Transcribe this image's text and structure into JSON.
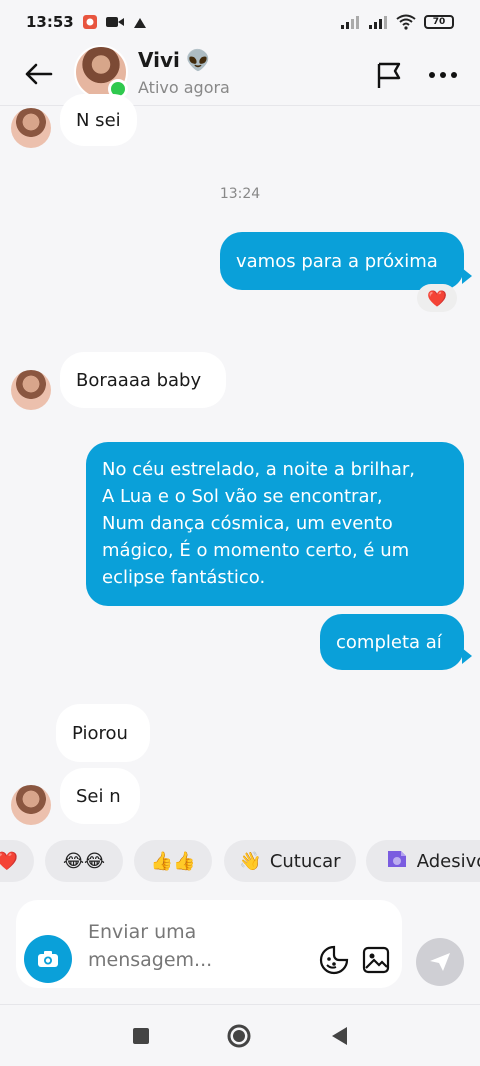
{
  "status_bar": {
    "time": "13:53",
    "battery": "70"
  },
  "header": {
    "name": "Vivi",
    "emoji": "👽",
    "status": "Ativo agora"
  },
  "messages": {
    "m1": "N sei",
    "time": "13:24",
    "m2": "vamos para a próxima",
    "m2_reaction": "❤️",
    "m3": "Boraaaa baby",
    "m4_lines": [
      "No céu estrelado, a noite a brilhar,",
      "A Lua e o Sol vão se encontrar,",
      "Num dança cósmica, um evento",
      "mágico, É o momento certo, é um",
      "eclipse fantástico."
    ],
    "m5": "completa aí",
    "m6": "Piorou",
    "m7": "Sei n"
  },
  "quick_replies": [
    {
      "emoji": "❤️",
      "label": ""
    },
    {
      "emoji": "😂😂",
      "label": ""
    },
    {
      "emoji": "👍👍",
      "label": ""
    },
    {
      "emoji": "👋",
      "label": "Cutucar"
    },
    {
      "emoji": "",
      "label": "Adesivo"
    }
  ],
  "composer": {
    "placeholder_line1": "Enviar uma",
    "placeholder_line2": "mensagem..."
  },
  "colors": {
    "accent": "#0AA0D9",
    "bg": "#F6F6F8",
    "incoming": "#FFFFFF",
    "online": "#2FC94E"
  }
}
